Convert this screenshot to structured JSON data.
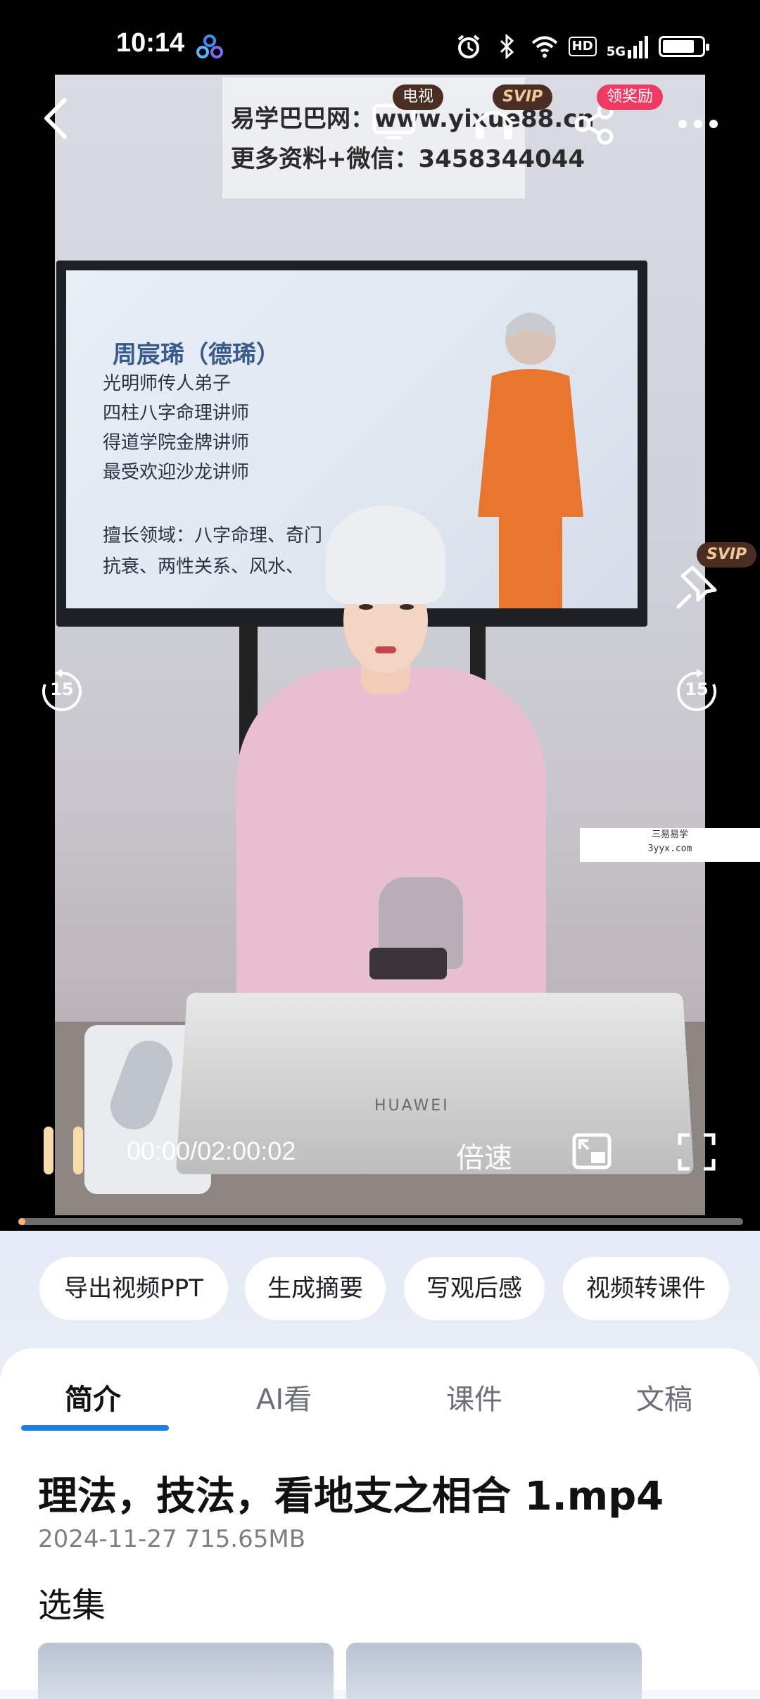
{
  "status_bar": {
    "time": "10:14",
    "icons": [
      "app-logo-icon",
      "alarm-icon",
      "bluetooth-icon",
      "wifi-icon",
      "hd-icon",
      "5g-signal-icon",
      "battery-icon"
    ],
    "hd": "HD",
    "network": "5G"
  },
  "video": {
    "watermark_line1": "易学巴巴网：www.yixue88.cn",
    "watermark_line2": "更多资料+微信：3458344044",
    "slide_title": "周宸琋（德琋）",
    "slide_lines": [
      "光明师传人弟子",
      "四柱八字命理讲师",
      "得道学院金牌讲师",
      "最受欢迎沙龙讲师",
      "擅长领域：八字命理、奇门",
      "抗衰、两性关系、风水、"
    ],
    "laptop_brand": "HUAWEI",
    "side_watermark_line1": "三易易学",
    "side_watermark_line2": "3yyx.com"
  },
  "overlay": {
    "badge_tv": "电视",
    "badge_svip": "SVIP",
    "badge_reward": "领奖励",
    "badge_svip_pin": "SVIP",
    "rewind_seconds": "15",
    "forward_seconds": "15",
    "current_time": "00:00",
    "total_time": "02:00:02",
    "speed": "倍速",
    "progress": 0.0
  },
  "actions": {
    "chips": [
      "导出视频PPT",
      "生成摘要",
      "写观后感",
      "视频转课件"
    ]
  },
  "tabs": [
    {
      "label": "简介",
      "active": true
    },
    {
      "label": "AI看",
      "active": false
    },
    {
      "label": "课件",
      "active": false
    },
    {
      "label": "文稿",
      "active": false
    }
  ],
  "file": {
    "title": "理法，技法，看地支之相合 1.mp4",
    "date": "2024-11-27",
    "size": "715.65MB"
  },
  "episodes": {
    "title": "选集"
  },
  "colors": {
    "accent": "#1d7fe6",
    "reward": "#f13a62",
    "progress": "#f6b07a"
  }
}
